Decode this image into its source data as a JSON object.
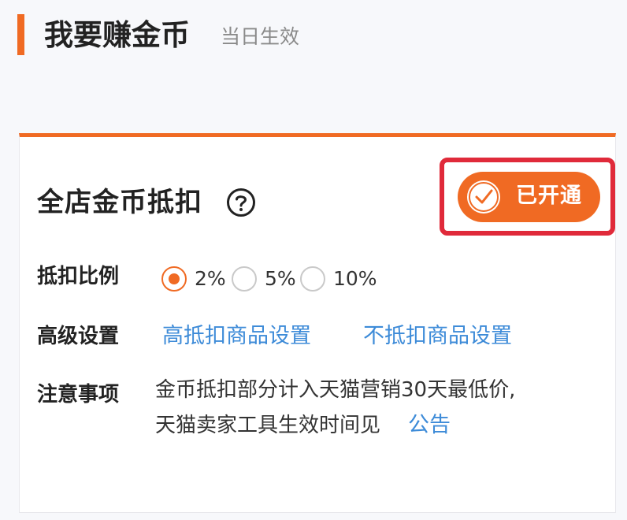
{
  "header": {
    "title": "我要赚金币",
    "subtitle": "当日生效"
  },
  "card": {
    "title": "全店金币抵扣",
    "help_icon": "question-circle-icon",
    "toggle": {
      "label": "已开通",
      "state": "on",
      "icon": "check-icon"
    },
    "deduction": {
      "label": "抵扣比例",
      "options": [
        {
          "label": "2%",
          "selected": true
        },
        {
          "label": "5%",
          "selected": false
        },
        {
          "label": "10%",
          "selected": false
        }
      ]
    },
    "advanced": {
      "label": "高级设置",
      "links": [
        "高抵扣商品设置",
        "不抵扣商品设置"
      ]
    },
    "notice": {
      "label": "注意事项",
      "line1": "金币抵扣部分计入天猫营销30天最低价,",
      "line2": "天猫卖家工具生效时间见",
      "link": "公告"
    }
  },
  "colors": {
    "accent": "#f06a23",
    "highlight": "#e02a3a",
    "link": "#3d8bd8"
  }
}
